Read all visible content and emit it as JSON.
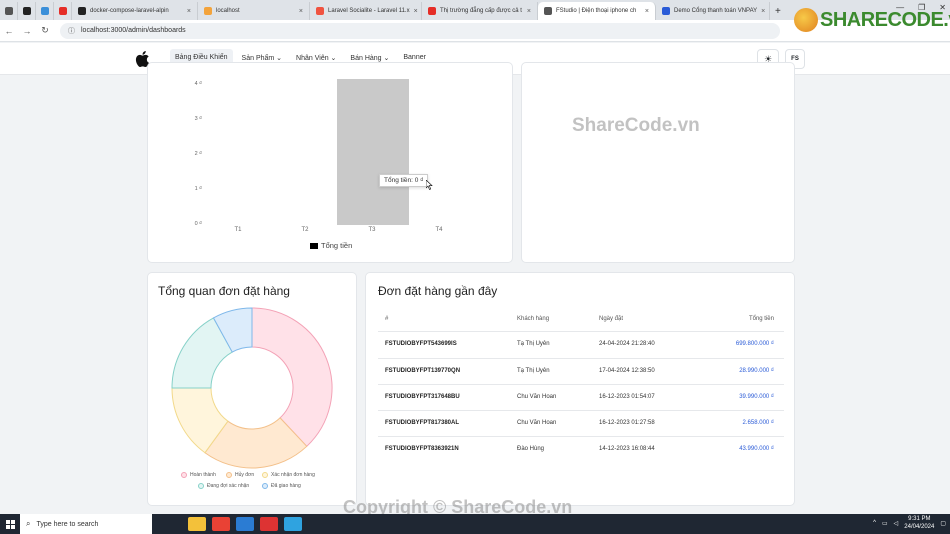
{
  "browser": {
    "tabs": [
      {
        "label": "",
        "color": "#555"
      },
      {
        "label": "",
        "color": "#222"
      },
      {
        "label": "",
        "color": "#3b8fd9"
      },
      {
        "label": "",
        "color": "#e52d27"
      },
      {
        "label": "docker-compose-laravel-alpin",
        "color": "#222"
      },
      {
        "label": "localhost",
        "color": "#f3a33b"
      },
      {
        "label": "Laravel Socialite - Laravel 11.x",
        "color": "#f05340"
      },
      {
        "label": "Thị trường đẳng cấp được cả t",
        "color": "#e52d27"
      },
      {
        "label": "FStudio | Điện thoại iphone ch",
        "color": "#555"
      },
      {
        "label": "Demo Cổng thanh toán VNPAY",
        "color": "#2a5bd7"
      }
    ],
    "new_tab": "+",
    "url": "localhost:3000/admin/dashboards"
  },
  "watermark": {
    "brand": "SHARECODE.vn",
    "center": "ShareCode.vn",
    "bottom": "Copyright © ShareCode.vn"
  },
  "navbar": {
    "items": [
      {
        "label": "Bảng Điều Khiển",
        "active": true
      },
      {
        "label": "Sản Phẩm ⌄",
        "active": false
      },
      {
        "label": "Nhân Viên ⌄",
        "active": false
      },
      {
        "label": "Bán Hàng ⌄",
        "active": false
      },
      {
        "label": "Banner",
        "active": false
      }
    ],
    "avatar": "FS",
    "theme_icon": "sun-icon"
  },
  "chart_data": [
    {
      "type": "bar",
      "categories": [
        "T1",
        "T2",
        "T3",
        "T4"
      ],
      "series": [
        {
          "name": "Tổng tiền",
          "values": [
            0,
            0,
            4,
            0
          ]
        }
      ],
      "ylim": [
        0,
        4
      ],
      "yticks": [
        "4 ₫",
        "3 ₫",
        "2 ₫",
        "1 ₫",
        "0 ₫"
      ],
      "tooltip": "Tổng tiền: 0 ₫",
      "bar_color": "#c9c9c9",
      "legend": "bottom"
    },
    {
      "type": "pie",
      "title": "Tổng quan đơn đặt hàng",
      "labels": [
        "Hoàn thành",
        "Hủy đơn",
        "Xác nhận đơn hàng",
        "Đang đợi xác nhận",
        "Đã giao hàng"
      ],
      "values": [
        38,
        22,
        15,
        17,
        8
      ],
      "fill_colors": [
        "#ffe1e8",
        "#ffe9d1",
        "#fff5dc",
        "#e2f5f3",
        "#dcecfb"
      ],
      "stroke_colors": [
        "#f3a2b6",
        "#f3c08a",
        "#f2d98a",
        "#86d1c8",
        "#7fb8ea"
      ],
      "legend": "bottom"
    }
  ],
  "orders": {
    "title": "Đơn đặt hàng gần đây",
    "headers": [
      "#",
      "Khách hàng",
      "Ngày đặt",
      "Tổng tiền"
    ],
    "rows": [
      {
        "code": "FSTUDIOBYFPT543699IS",
        "customer": "Tạ Thị Uyên",
        "date": "24-04-2024 21:28:40",
        "total": "699.800.000 ₫"
      },
      {
        "code": "FSTUDIOBYFPT139770QN",
        "customer": "Tạ Thị Uyên",
        "date": "17-04-2024 12:38:50",
        "total": "28.990.000 ₫"
      },
      {
        "code": "FSTUDIOBYFPT317648BU",
        "customer": "Chu Văn Hoan",
        "date": "16-12-2023 01:54:07",
        "total": "39.990.000 ₫"
      },
      {
        "code": "FSTUDIOBYFPT817380AL",
        "customer": "Chu Văn Hoan",
        "date": "16-12-2023 01:27:58",
        "total": "2.658.000 ₫"
      },
      {
        "code": "FSTUDIOBYFPT8363921N",
        "customer": "Đào Hùng",
        "date": "14-12-2023 16:08:44",
        "total": "43.990.000 ₫"
      }
    ]
  },
  "taskbar": {
    "search_placeholder": "Type here to search",
    "time": "9:31 PM",
    "date": "24/04/2024",
    "apps": [
      "#f3c13a",
      "#e94235",
      "#2b7cd3",
      "#d33",
      "#2fa3e0"
    ]
  }
}
